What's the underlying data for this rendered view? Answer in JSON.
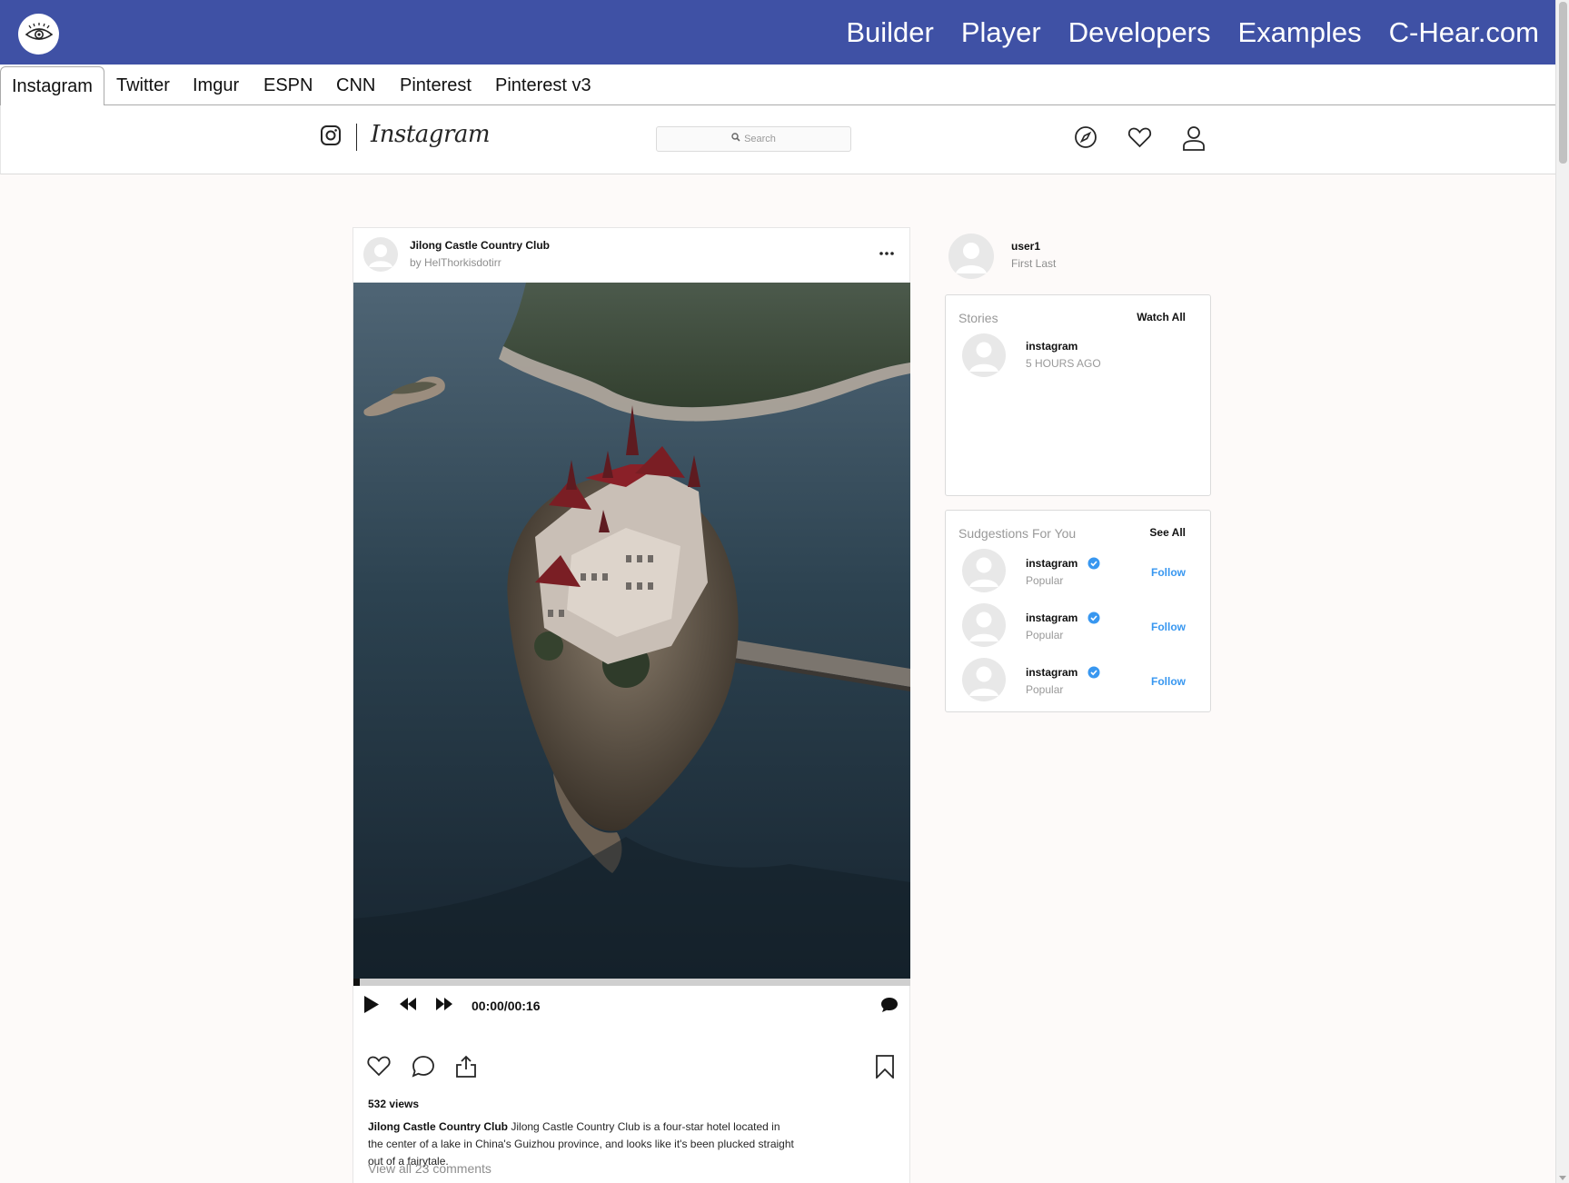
{
  "topbar": {
    "logo_icon": "eye-icon",
    "nav": [
      "Builder",
      "Player",
      "Developers",
      "Examples",
      "C-Hear.com"
    ],
    "background": "#3f51a5"
  },
  "tabs": {
    "items": [
      "Instagram",
      "Twitter",
      "Imgur",
      "ESPN",
      "CNN",
      "Pinterest",
      "Pinterest v3"
    ],
    "active": "Instagram"
  },
  "ig_header": {
    "wordmark": "Instagram",
    "search_placeholder": "Search",
    "icons": [
      "compass-icon",
      "heart-icon",
      "user-icon"
    ]
  },
  "post": {
    "title": "Jilong Castle Country Club",
    "author": "by HelThorkisdotirr",
    "media": "aerial photo of a castle on a rocky island in a lake",
    "player": {
      "time": "00:00/00:16",
      "progress": 0
    },
    "views": "532 views",
    "caption_user": "Jilong Castle Country Club",
    "caption_text": "Jilong Castle Country Club is a four-star hotel located in the center of a lake in China's Guizhou province, and looks like it's been plucked straight out of a fairytale.",
    "comments_link": "View all 23 comments"
  },
  "profile": {
    "username": "user1",
    "full_name": "First Last"
  },
  "stories": {
    "title": "Stories",
    "link": "Watch All",
    "items": [
      {
        "name": "instagram",
        "time": "5 HOURS AGO"
      }
    ]
  },
  "suggestions": {
    "title": "Sudgestions For You",
    "link": "See All",
    "items": [
      {
        "name": "instagram",
        "sub": "Popular",
        "action": "Follow"
      },
      {
        "name": "instagram",
        "sub": "Popular",
        "action": "Follow"
      },
      {
        "name": "instagram",
        "sub": "Popular",
        "action": "Follow"
      }
    ]
  },
  "colors": {
    "accent": "#3f51a5",
    "link_blue": "#3897f0",
    "page_bg": "#fdfaf9"
  }
}
